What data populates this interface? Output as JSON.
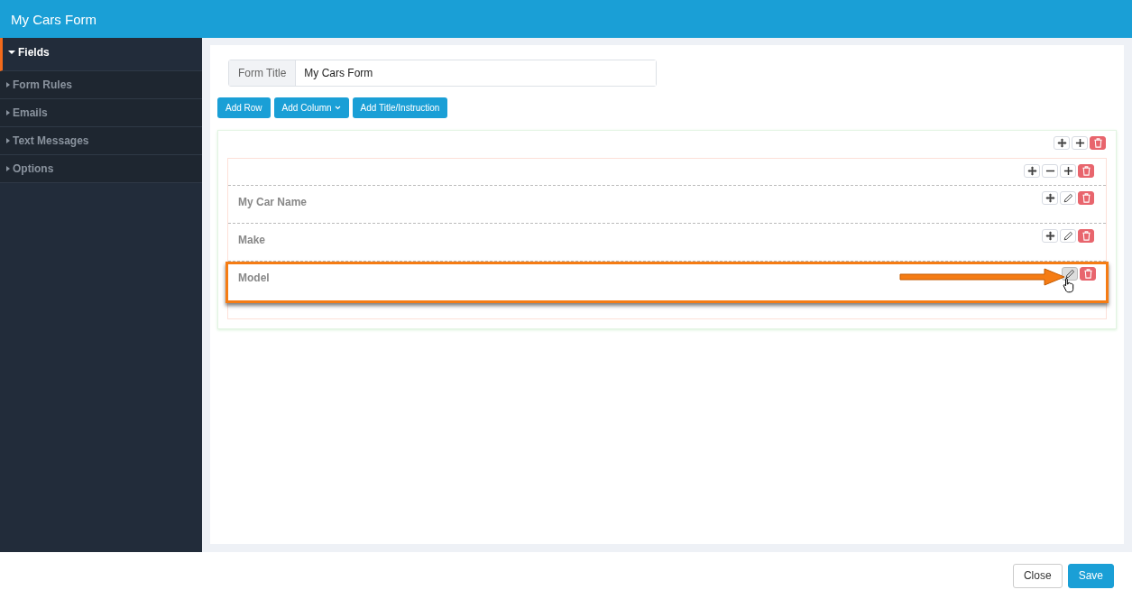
{
  "window": {
    "title": "My Cars Form"
  },
  "sidebar": {
    "items": [
      {
        "label": "Fields",
        "selected": true,
        "expanded": true
      },
      {
        "label": "Form Rules",
        "selected": false,
        "expanded": false
      },
      {
        "label": "Emails",
        "selected": false,
        "expanded": false
      },
      {
        "label": "Text Messages",
        "selected": false,
        "expanded": false
      },
      {
        "label": "Options",
        "selected": false,
        "expanded": false
      }
    ]
  },
  "form_title": {
    "label": "Form Title",
    "value": "My Cars Form"
  },
  "toolbar": [
    {
      "label": "Add Row",
      "dropdown": false
    },
    {
      "label": "Add Column",
      "dropdown": true
    },
    {
      "label": "Add Title/Instruction",
      "dropdown": false
    }
  ],
  "fields": [
    {
      "label": "My Car Name",
      "highlighted": false
    },
    {
      "label": "Make",
      "highlighted": false
    },
    {
      "label": "Model",
      "highlighted": true
    }
  ],
  "footer": {
    "buttons": [
      {
        "label": "Close",
        "kind": "secondary"
      },
      {
        "label": "Save",
        "kind": "primary"
      }
    ]
  }
}
